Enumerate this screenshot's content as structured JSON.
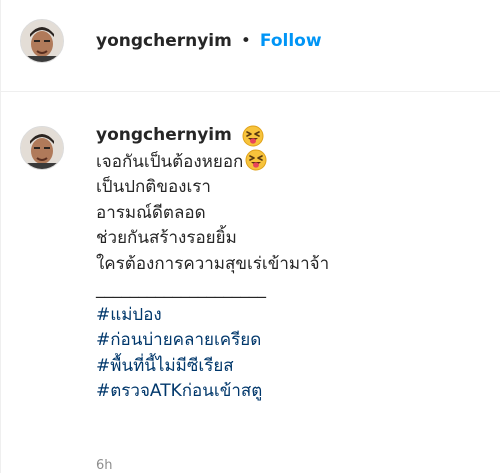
{
  "header": {
    "username": "yongchernyim",
    "separator": "•",
    "follow_label": "Follow"
  },
  "caption": {
    "username": "yongchernyim",
    "lines": [
      "เจอกันเป็นต้องหยอก",
      "เป็นปกติของเรา",
      "อารมณ์ดีตลอด",
      "ช่วยกันสร้างรอยยิ้ม",
      "ใครต้องการความสุขเร่เข้ามาจ้า",
      "____________________"
    ],
    "hashtags": [
      "#แม่ปอง",
      "#ก่อนบ่ายคลายเครียด",
      "#พื้นที่นี้ไม่มีซีเรียส",
      "#ตรวจATKก่อนเข้าสตู"
    ],
    "timestamp": "6h"
  },
  "icons": {
    "emoji": "squinting-face-with-tongue-emoji"
  },
  "colors": {
    "link_blue": "#0095f6",
    "hashtag_blue": "#00376b",
    "text": "#262626",
    "muted": "#8e8e8e"
  }
}
